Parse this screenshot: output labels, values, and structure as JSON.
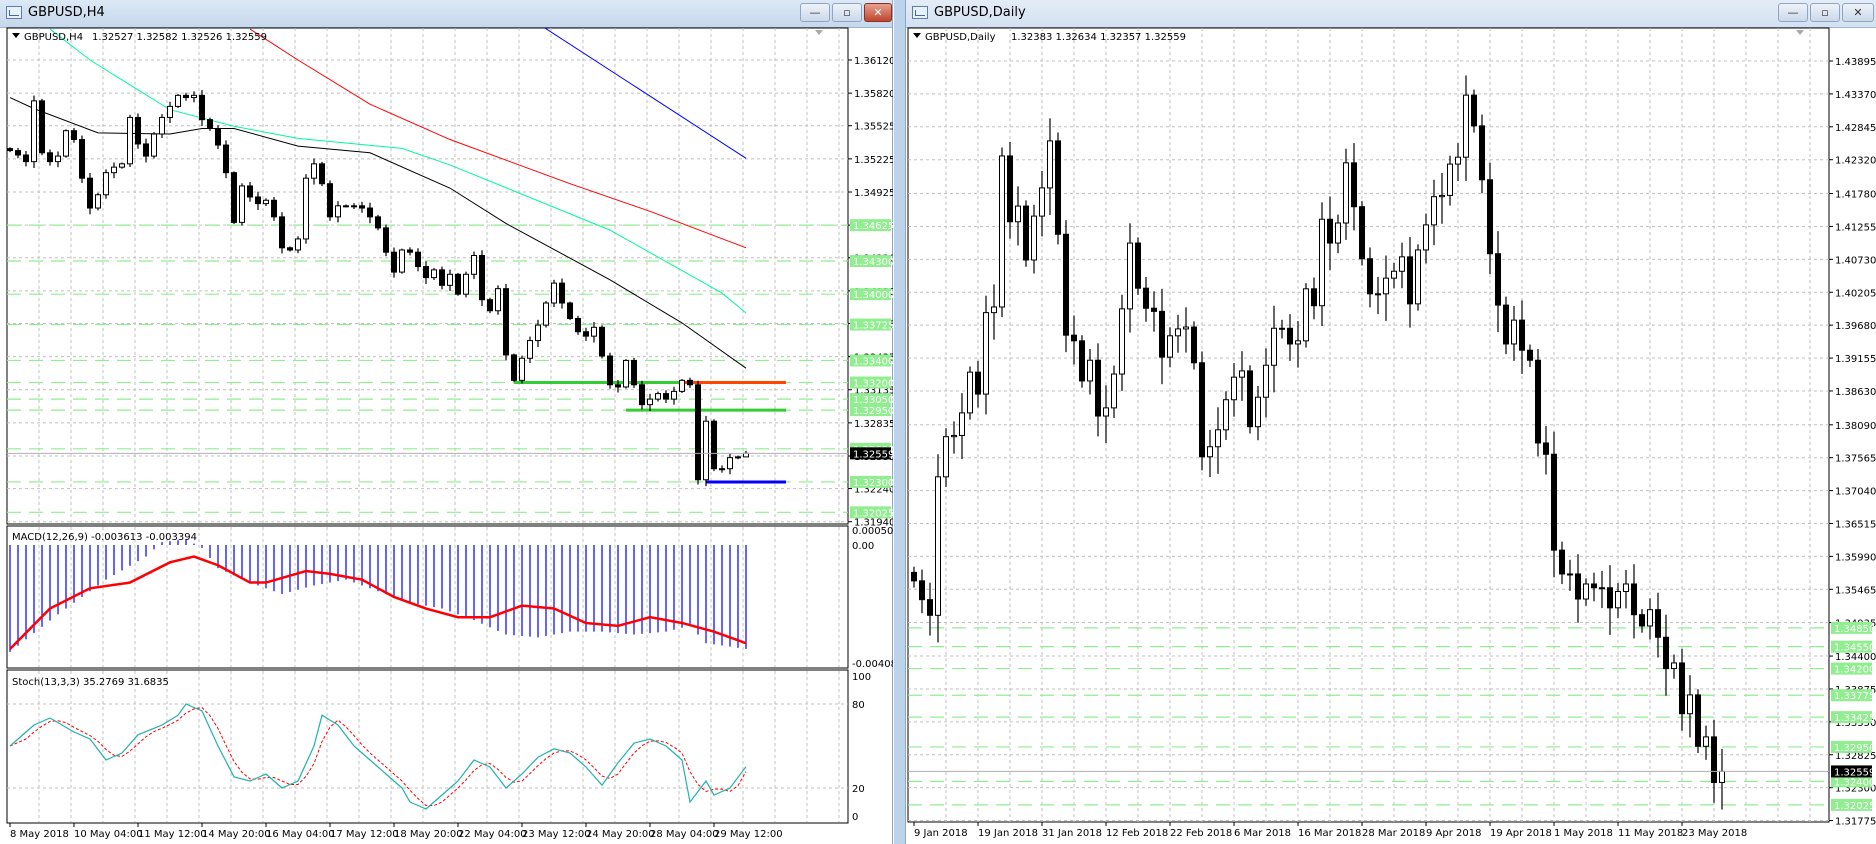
{
  "windows": {
    "left": {
      "title": "GBPUSD,H4",
      "buttons": {
        "minimize": "—",
        "restore": "▫",
        "close": "✕"
      },
      "chart_header": {
        "symbol": "GBPUSD,H4",
        "ohlc": "1.32527 1.32582 1.32526 1.32559"
      },
      "macd_label": "MACD(12,26,9) -0.003613 -0.003394",
      "stoch_label": "Stoch(13,3,3) 35.2769 31.6835"
    },
    "right": {
      "title": "GBPUSD,Daily",
      "buttons": {
        "minimize": "—",
        "restore": "▫",
        "close": "✕"
      },
      "chart_header": {
        "symbol": "GBPUSD,Daily",
        "ohlc": "1.32383 1.32634 1.32357 1.32559"
      }
    }
  },
  "colors": {
    "bull_fill": "#ffffff",
    "bear_fill": "#000000",
    "grid": "#c0c0c0",
    "level": "#90ee90",
    "ma_blue": "#0000ff",
    "ma_red": "#ff0000",
    "ma_green": "#00fa9a",
    "ma_black": "#000000",
    "macd_hist": "#0000ff",
    "macd_signal": "#ff0000",
    "stoch_main": "#20b2aa",
    "stoch_signal": "#ff0000"
  },
  "chart_data": [
    {
      "type": "candlestick",
      "title": "GBPUSD,H4",
      "ylim": [
        1.3194,
        1.3612
      ],
      "y_ticks": [
        "1.36120",
        "1.35820",
        "1.35525",
        "1.35225",
        "1.34925",
        "1.34625",
        "1.34330",
        "1.34030",
        "1.33735",
        "1.33435",
        "1.33135",
        "1.32835",
        "1.32535",
        "1.32240",
        "1.31940"
      ],
      "x_labels": [
        "8 May 2018",
        "10 May 04:00",
        "11 May 12:00",
        "14 May 20:00",
        "16 May 04:00",
        "17 May 12:00",
        "18 May 20:00",
        "22 May 04:00",
        "23 May 12:00",
        "24 May 20:00",
        "28 May 04:00",
        "29 May 12:00"
      ],
      "x_label_every": 8,
      "closes": [
        1.353,
        1.3526,
        1.352,
        1.3575,
        1.3528,
        1.352,
        1.3525,
        1.3548,
        1.354,
        1.3505,
        1.3478,
        1.349,
        1.351,
        1.3515,
        1.3518,
        1.356,
        1.3536,
        1.3525,
        1.3545,
        1.356,
        1.357,
        1.358,
        1.3578,
        1.358,
        1.3558,
        1.355,
        1.3535,
        1.351,
        1.3465,
        1.3498,
        1.3488,
        1.3482,
        1.3485,
        1.347,
        1.3442,
        1.344,
        1.345,
        1.3505,
        1.3518,
        1.35,
        1.347,
        1.348,
        1.348,
        1.348,
        1.3478,
        1.347,
        1.346,
        1.3438,
        1.342,
        1.344,
        1.3438,
        1.3425,
        1.3415,
        1.3422,
        1.3408,
        1.3418,
        1.34,
        1.3418,
        1.3435,
        1.3395,
        1.3385,
        1.3405,
        1.3345,
        1.3322,
        1.3342,
        1.3358,
        1.3372,
        1.3392,
        1.341,
        1.3392,
        1.3378,
        1.3366,
        1.3362,
        1.337,
        1.3344,
        1.3318,
        1.3316,
        1.334,
        1.3318,
        1.33,
        1.3305,
        1.331,
        1.3305,
        1.3312,
        1.3322,
        1.3318,
        1.3232,
        1.3285,
        1.3242,
        1.3242,
        1.3252,
        1.32527,
        1.32559
      ],
      "last_bar": {
        "open": 1.32527,
        "high": 1.32582,
        "low": 1.32526,
        "close": 1.32559
      },
      "moving_averages": [
        {
          "color": "#0000ff",
          "points": [
            [
              66,
              1.3645
            ],
            [
              92,
              1.3523
            ]
          ]
        },
        {
          "color": "#ff0000",
          "points": [
            [
              30,
              1.364
            ],
            [
              36,
              1.3612
            ],
            [
              45,
              1.3572
            ],
            [
              55,
              1.354
            ],
            [
              70,
              1.35
            ],
            [
              80,
              1.3475
            ],
            [
              92,
              1.3442
            ]
          ]
        },
        {
          "color": "#00fa9a",
          "points": [
            [
              5,
              1.364
            ],
            [
              10,
              1.3612
            ],
            [
              20,
              1.3567
            ],
            [
              28,
              1.3552
            ],
            [
              36,
              1.3541
            ],
            [
              49,
              1.3532
            ],
            [
              55,
              1.3517
            ],
            [
              75,
              1.3458
            ],
            [
              89,
              1.3401
            ],
            [
              92,
              1.3383
            ]
          ]
        },
        {
          "color": "#000000",
          "points": [
            [
              0,
              1.3578
            ],
            [
              3,
              1.3568
            ],
            [
              11,
              1.3546
            ],
            [
              20,
              1.3545
            ],
            [
              24,
              1.355
            ],
            [
              28,
              1.355
            ],
            [
              36,
              1.3534
            ],
            [
              45,
              1.3528
            ],
            [
              55,
              1.3496
            ],
            [
              62,
              1.3464
            ],
            [
              75,
              1.3413
            ],
            [
              84,
              1.3374
            ],
            [
              92,
              1.3333
            ]
          ]
        }
      ],
      "levels": [
        {
          "price": "1.34625"
        },
        {
          "price": "1.34300"
        },
        {
          "price": "1.34000"
        },
        {
          "price": "1.33725"
        },
        {
          "price": "1.33400"
        },
        {
          "price": "1.33200"
        },
        {
          "price": "1.33050"
        },
        {
          "price": "1.32950"
        },
        {
          "price": "1.32600"
        },
        {
          "price": "1.32300"
        },
        {
          "price": "1.32025"
        }
      ],
      "trend_segments": [
        {
          "price": 1.332,
          "from": 63,
          "to": 97,
          "color": "#33cc33"
        },
        {
          "price": 1.332,
          "from": 84,
          "to": 97,
          "color": "#ff4500"
        },
        {
          "price": 1.3295,
          "from": 77,
          "to": 97,
          "color": "#33cc33"
        },
        {
          "price": 1.323,
          "from": 87,
          "to": 97,
          "color": "#0000ff"
        }
      ],
      "bid": "1.32559"
    },
    {
      "type": "bar",
      "title": "MACD(12,26,9)",
      "y_ticks": [
        "0.000507",
        "0.00",
        "-0.004086"
      ],
      "histogram_points": [
        [
          0,
          -0.0037
        ],
        [
          6,
          -0.0024
        ],
        [
          12,
          -0.0012
        ],
        [
          17,
          -0.0004
        ],
        [
          19,
          0.0001
        ],
        [
          22,
          0.0002
        ],
        [
          24,
          -0.0001
        ],
        [
          26,
          -0.0008
        ],
        [
          30,
          -0.0013
        ],
        [
          34,
          -0.0017
        ],
        [
          38,
          -0.0014
        ],
        [
          42,
          -0.0012
        ],
        [
          46,
          -0.0016
        ],
        [
          50,
          -0.002
        ],
        [
          54,
          -0.0022
        ],
        [
          58,
          -0.0026
        ],
        [
          62,
          -0.0031
        ],
        [
          66,
          -0.0032
        ],
        [
          70,
          -0.003
        ],
        [
          74,
          -0.003
        ],
        [
          78,
          -0.0031
        ],
        [
          82,
          -0.003
        ],
        [
          85,
          -0.0028
        ],
        [
          87,
          -0.0034
        ],
        [
          92,
          -0.0036
        ]
      ],
      "signal_points": [
        [
          0,
          -0.0036
        ],
        [
          5,
          -0.0022
        ],
        [
          10,
          -0.0015
        ],
        [
          15,
          -0.0013
        ],
        [
          20,
          -0.0006
        ],
        [
          23,
          -0.0004
        ],
        [
          26,
          -0.0007
        ],
        [
          30,
          -0.0013
        ],
        [
          32,
          -0.0013
        ],
        [
          37,
          -0.0009
        ],
        [
          40,
          -0.001
        ],
        [
          44,
          -0.0012
        ],
        [
          48,
          -0.0018
        ],
        [
          52,
          -0.0022
        ],
        [
          56,
          -0.0025
        ],
        [
          60,
          -0.0025
        ],
        [
          64,
          -0.0021
        ],
        [
          68,
          -0.0022
        ],
        [
          72,
          -0.0027
        ],
        [
          76,
          -0.0028
        ],
        [
          80,
          -0.0025
        ],
        [
          84,
          -0.0027
        ],
        [
          88,
          -0.003
        ],
        [
          92,
          -0.0034
        ]
      ],
      "last": {
        "macd": -0.003613,
        "signal": -0.003394
      }
    },
    {
      "type": "line",
      "title": "Stoch(13,3,3)",
      "y_ticks": [
        "100",
        "80",
        "20",
        "0"
      ],
      "main_points": [
        [
          0,
          50
        ],
        [
          3,
          65
        ],
        [
          5,
          70
        ],
        [
          8,
          60
        ],
        [
          10,
          55
        ],
        [
          12,
          40
        ],
        [
          14,
          45
        ],
        [
          16,
          58
        ],
        [
          19,
          65
        ],
        [
          21,
          72
        ],
        [
          22,
          80
        ],
        [
          24,
          75
        ],
        [
          26,
          50
        ],
        [
          28,
          28
        ],
        [
          30,
          25
        ],
        [
          32,
          30
        ],
        [
          34,
          20
        ],
        [
          36,
          25
        ],
        [
          38,
          50
        ],
        [
          39,
          72
        ],
        [
          41,
          65
        ],
        [
          43,
          50
        ],
        [
          45,
          40
        ],
        [
          47,
          30
        ],
        [
          49,
          20
        ],
        [
          50,
          10
        ],
        [
          52,
          5
        ],
        [
          54,
          15
        ],
        [
          56,
          25
        ],
        [
          58,
          40
        ],
        [
          60,
          35
        ],
        [
          62,
          20
        ],
        [
          64,
          30
        ],
        [
          66,
          42
        ],
        [
          68,
          48
        ],
        [
          70,
          45
        ],
        [
          72,
          35
        ],
        [
          74,
          22
        ],
        [
          76,
          38
        ],
        [
          78,
          52
        ],
        [
          80,
          55
        ],
        [
          82,
          50
        ],
        [
          84,
          40
        ],
        [
          85,
          10
        ],
        [
          87,
          25
        ],
        [
          88,
          15
        ],
        [
          90,
          20
        ],
        [
          92,
          35.2769
        ]
      ],
      "last": {
        "main": 35.2769,
        "signal": 31.6835
      }
    },
    {
      "type": "candlestick",
      "title": "GBPUSD,Daily",
      "ylim": [
        1.31775,
        1.43895
      ],
      "y_ticks": [
        "1.43895",
        "1.43370",
        "1.42845",
        "1.42320",
        "1.41780",
        "1.41255",
        "1.40730",
        "1.40205",
        "1.39680",
        "1.39155",
        "1.38630",
        "1.38090",
        "1.37565",
        "1.37040",
        "1.36515",
        "1.35990",
        "1.35465",
        "1.34935",
        "1.34400",
        "1.33875",
        "1.33350",
        "1.32825",
        "1.32300",
        "1.31775"
      ],
      "x_labels": [
        "9 Jan 2018",
        "19 Jan 2018",
        "31 Jan 2018",
        "12 Feb 2018",
        "22 Feb 2018",
        "6 Mar 2018",
        "16 Mar 2018",
        "28 Mar 2018",
        "9 Apr 2018",
        "19 Apr 2018",
        "1 May 2018",
        "11 May 2018",
        "23 May 2018"
      ],
      "x_label_every": 8,
      "closes": [
        1.356,
        1.353,
        1.3505,
        1.3726,
        1.379,
        1.3792,
        1.3828,
        1.3893,
        1.3858,
        1.3988,
        1.3997,
        1.4238,
        1.4133,
        1.4158,
        1.4072,
        1.4142,
        1.4187,
        1.4262,
        1.4113,
        1.3952,
        1.3943,
        1.3879,
        1.3912,
        1.3823,
        1.3836,
        1.389,
        1.3994,
        1.4099,
        1.4027,
        1.3995,
        1.399,
        1.3917,
        1.3951,
        1.3962,
        1.3965,
        1.3908,
        1.3758,
        1.3774,
        1.3801,
        1.3849,
        1.3885,
        1.3895,
        1.3806,
        1.3853,
        1.3904,
        1.3963,
        1.3963,
        1.3938,
        1.3943,
        1.4026,
        1.3999,
        1.4137,
        1.4099,
        1.4131,
        1.4227,
        1.4157,
        1.4074,
        1.4018,
        1.4018,
        1.4043,
        1.4054,
        1.4077,
        1.4002,
        1.4088,
        1.4128,
        1.4173,
        1.4175,
        1.4225,
        1.4236,
        1.4335,
        1.4286,
        1.42,
        1.4082,
        1.4,
        1.3938,
        1.3976,
        1.3928,
        1.3912,
        1.378,
        1.3762,
        1.3609,
        1.3571,
        1.3571,
        1.3531,
        1.3555,
        1.3549,
        1.3549,
        1.3517,
        1.3543,
        1.3555,
        1.3506,
        1.3488,
        1.3514,
        1.347,
        1.342,
        1.3429,
        1.3348,
        1.3378,
        1.3296,
        1.3311,
        1.32383,
        1.32559
      ],
      "levels": [
        {
          "price": "1.34850"
        },
        {
          "price": "1.34550"
        },
        {
          "price": "1.34200"
        },
        {
          "price": "1.33775"
        },
        {
          "price": "1.33425"
        },
        {
          "price": "1.32950"
        },
        {
          "price": "1.32400"
        },
        {
          "price": "1.32025"
        }
      ],
      "bid": "1.32559"
    }
  ]
}
